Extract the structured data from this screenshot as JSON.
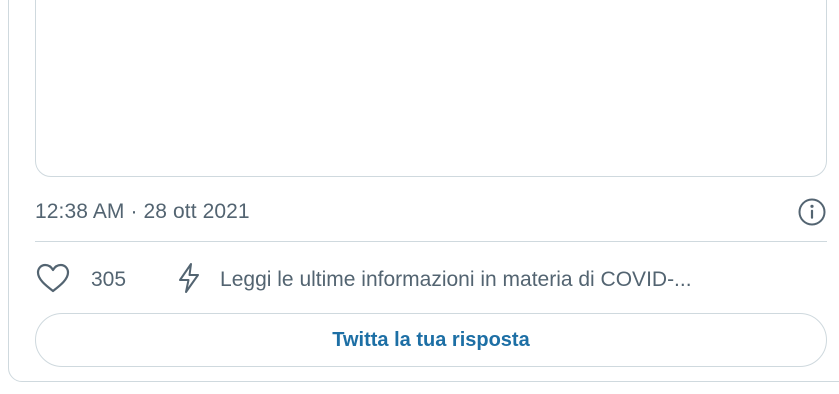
{
  "tweet": {
    "timestamp": "12:38 AM · 28 ott 2021",
    "likes": "305",
    "covid_notice": "Leggi le ultime informazioni in materia di COVID-...",
    "reply_button_label": "Twitta la tua risposta"
  },
  "icons": {
    "info": "info-circle-icon",
    "like": "heart-outline-icon",
    "notice": "lightning-bolt-icon"
  },
  "colors": {
    "accent": "#1d6fa5",
    "secondary_text": "#536471",
    "border": "#cfd9de"
  }
}
